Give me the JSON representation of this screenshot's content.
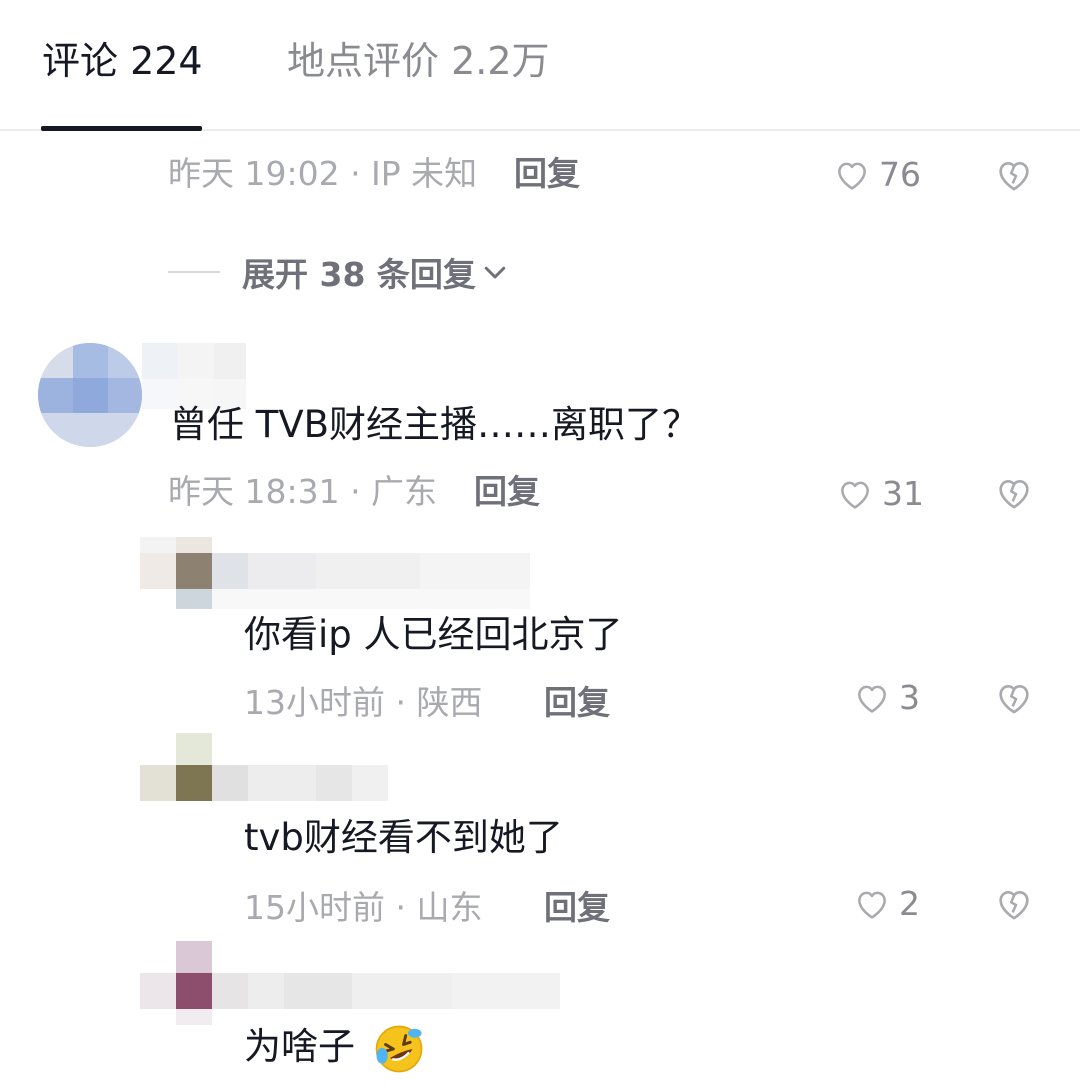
{
  "tabs": {
    "comments_label": "评论 224",
    "places_label": "地点评价 2.2万"
  },
  "thread0": {
    "meta": "昨天 19:02 · IP 未知",
    "reply_label": "回复",
    "likes": "76",
    "expand_label": "展开 38 条回复"
  },
  "comments": [
    {
      "text": "曾任 TVB财经主播……离职了？",
      "meta": "昨天 18:31 · 广东",
      "reply_label": "回复",
      "likes": "31"
    },
    {
      "text": "你看ip  人已经回北京了",
      "meta": "13小时前 · 陕西",
      "reply_label": "回复",
      "likes": "3"
    },
    {
      "text": "tvb财经看不到她了",
      "meta": "15小时前 · 山东",
      "reply_label": "回复",
      "likes": "2"
    },
    {
      "text": "为啥子",
      "emoji": "🤣"
    }
  ],
  "colors": {
    "text_primary": "#161823",
    "text_secondary": "#a9aab0",
    "reply": "#6f7079",
    "divider": "#ececec"
  }
}
